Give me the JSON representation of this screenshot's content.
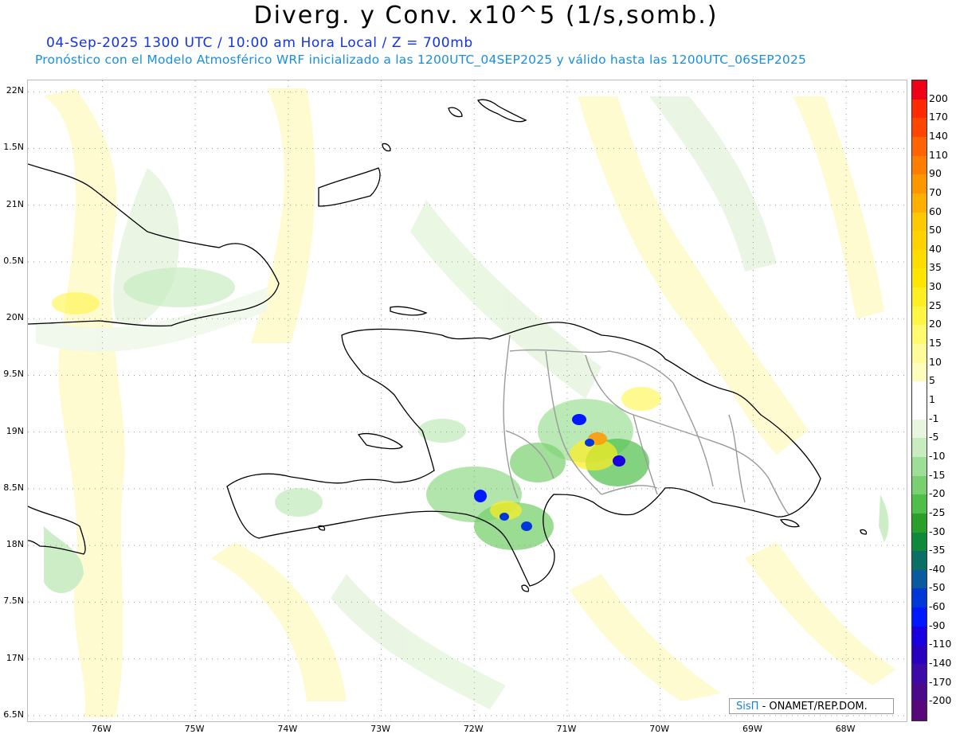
{
  "header": {
    "title": "Diverg. y Conv. x10^5 (1/s,somb.)",
    "line1": "04-Sep-2025 1300 UTC / 10:00 am Hora Local / Z = 700mb",
    "line2": "Pronóstico con el Modelo Atmosférico WRF inicializado a las 1200UTC_04SEP2025 y válido hasta las  1200UTC_06SEP2025",
    "line1_color": "#1133ee",
    "line2_color": "#1a8fe0"
  },
  "map": {
    "lat_labels": [
      "22N",
      "1.5N",
      "21N",
      "0.5N",
      "20N",
      "9.5N",
      "19N",
      "8.5N",
      "18N",
      "7.5N",
      "17N",
      "6.5N"
    ],
    "lon_labels": [
      "76W",
      "75W",
      "74W",
      "73W",
      "72W",
      "71W",
      "70W",
      "69W",
      "68W"
    ],
    "lon_range": [
      -76.8,
      -67.35
    ],
    "lat_range": [
      16.45,
      22.1
    ]
  },
  "colorbar": {
    "labels": [
      "200",
      "170",
      "140",
      "110",
      "90",
      "70",
      "60",
      "50",
      "40",
      "35",
      "30",
      "25",
      "20",
      "15",
      "10",
      "5",
      "1",
      "-1",
      "-5",
      "-10",
      "-15",
      "-20",
      "-25",
      "-30",
      "-35",
      "-40",
      "-50",
      "-60",
      "-90",
      "-110",
      "-140",
      "-170",
      "-200"
    ],
    "colors": [
      "#f00016",
      "#ff2a00",
      "#ff4600",
      "#ff6400",
      "#ff7d00",
      "#ff9600",
      "#ffaf00",
      "#ffc800",
      "#ffd200",
      "#ffdc00",
      "#ffe600",
      "#ffee22",
      "#fff544",
      "#fffa6e",
      "#fffb99",
      "#fffdbb",
      "#ffffff",
      "#ffffff",
      "#e8f6e0",
      "#c7ecc0",
      "#9edf97",
      "#78d06e",
      "#4fbf4a",
      "#2aa02a",
      "#0e8a3a",
      "#0a7066",
      "#0a5aa0",
      "#0037d8",
      "#0018ff",
      "#1a00e0",
      "#2a00c0",
      "#3c0aa6",
      "#4a0a8a",
      "#58087a"
    ]
  },
  "credit": {
    "brand": "SisΠ",
    "text": "- ONAMET/REP.DOM."
  }
}
